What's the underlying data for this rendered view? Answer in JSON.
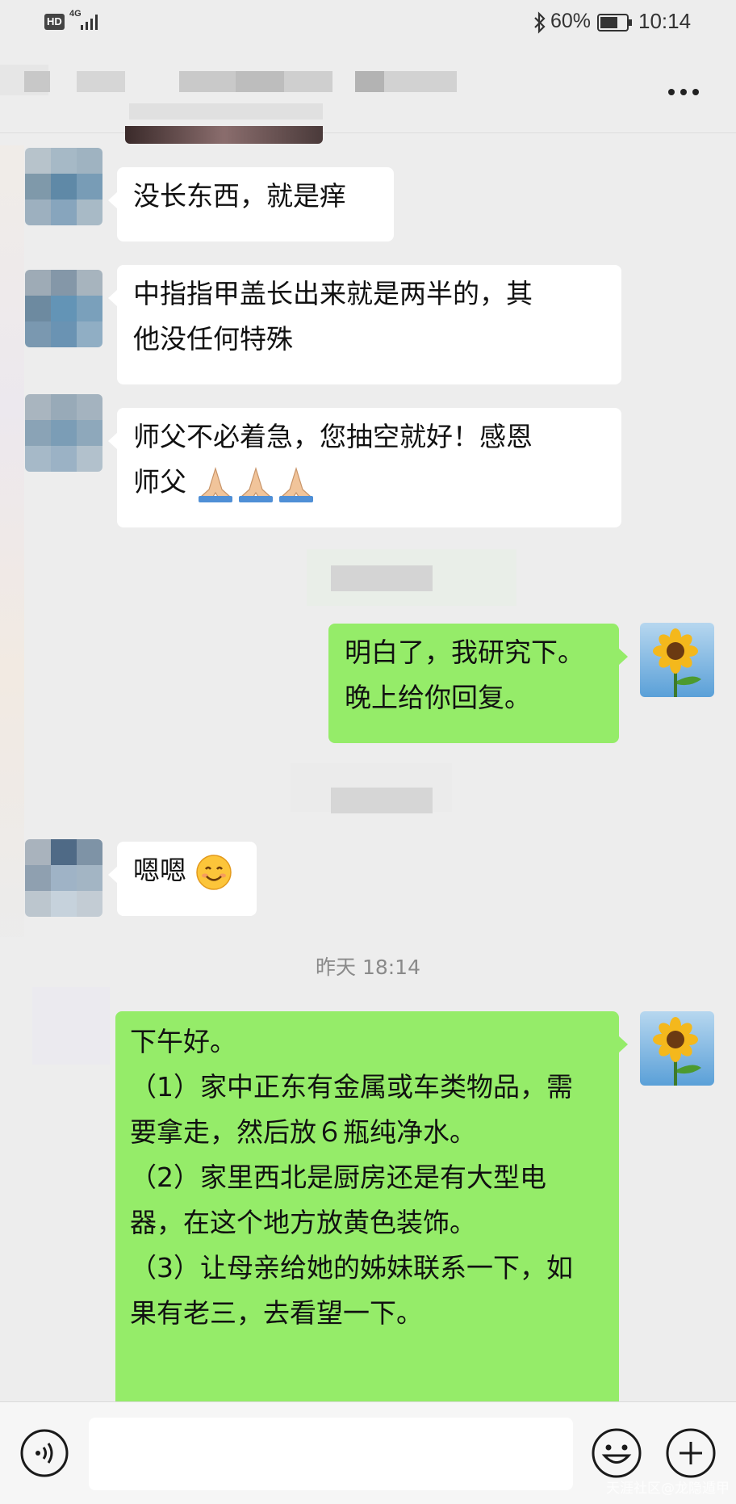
{
  "status": {
    "hd": "HD",
    "network": "4G",
    "battery": "60%",
    "time": "10:14"
  },
  "messages": [
    {
      "side": "left",
      "text": "没长东西，就是痒"
    },
    {
      "side": "left",
      "lines": [
        "中指指甲盖长出来就是两半的，其",
        "他没任何特殊"
      ]
    },
    {
      "side": "left",
      "lines": [
        "师父不必着急，您抽空就好！感恩",
        "师父"
      ],
      "emoji": "folded-hands x3"
    },
    {
      "side": "right",
      "lines": [
        "明白了，我研究下。",
        "晚上给你回复。"
      ]
    },
    {
      "side": "left",
      "text": "嗯嗯",
      "emoji": "smiling-face"
    },
    {
      "side": "right",
      "lines": [
        "下午好。",
        "（1）家中正东有金属或车类物品，需",
        "要拿走，然后放６瓶纯净水。",
        "（2）家里西北是厨房还是有大型电",
        "器，在这个地方放黄色装饰。",
        "（3）让母亲给她的姊妹联系一下，如",
        "果有老三，去看望一下。"
      ]
    }
  ],
  "timestamp": "昨天 18:14",
  "watermark": "天涯社区@龙隐遁甲",
  "colors": {
    "background": "#ededed",
    "left_bubble": "#ffffff",
    "right_bubble": "#95ec69",
    "timestamp": "#8a8a8a"
  }
}
